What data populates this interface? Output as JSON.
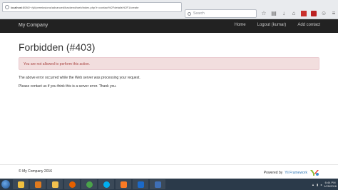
{
  "browser": {
    "url_host": "localhost",
    "url_rest": ":8080/~/yii/permissions/advanced/backend/web/index.php?r=contact%2Fdetails%2F1/create",
    "search_placeholder": "Search",
    "icons": [
      "star-icon",
      "bookmarks-icon",
      "downloads-icon",
      "home-icon",
      "addon-red-icon",
      "addon-red2-icon",
      "menu-icon"
    ]
  },
  "navbar": {
    "brand": "My Company",
    "links": [
      {
        "label": "Home"
      },
      {
        "label": "Logout (kumar)"
      },
      {
        "label": "Add contact"
      }
    ]
  },
  "main": {
    "title": "Forbidden (#403)",
    "alert": "You are not allowed to perform this action.",
    "paragraph1": "The above error occurred while the Web server was processing your request.",
    "paragraph2": "Please contact us if you think this is a server error. Thank you."
  },
  "footer": {
    "copyright": "© My Company 2016",
    "powered_by": "Powered by",
    "yii_link": "Yii Framework"
  },
  "taskbar": {
    "time": "6:44 PM",
    "date": "1/25/2016",
    "apps": [
      {
        "name": "explorer-icon",
        "color": "#f0c040"
      },
      {
        "name": "media-player-icon",
        "color": "#e07a1f"
      },
      {
        "name": "folder-icon",
        "color": "#f2c14e"
      },
      {
        "name": "firefox-icon",
        "color": "#e66000"
      },
      {
        "name": "chrome-icon",
        "color": "#4aa34a"
      },
      {
        "name": "skype-icon",
        "color": "#00aff0"
      },
      {
        "name": "xampp-icon",
        "color": "#fb7a24"
      },
      {
        "name": "netbeans-icon",
        "color": "#1b6ac9"
      },
      {
        "name": "virtualbox-icon",
        "color": "#3f6fb6"
      }
    ]
  },
  "colors": {
    "navbar_bg": "#222222",
    "alert_bg": "#f2dede",
    "alert_text": "#a94442",
    "link": "#337ab7"
  }
}
